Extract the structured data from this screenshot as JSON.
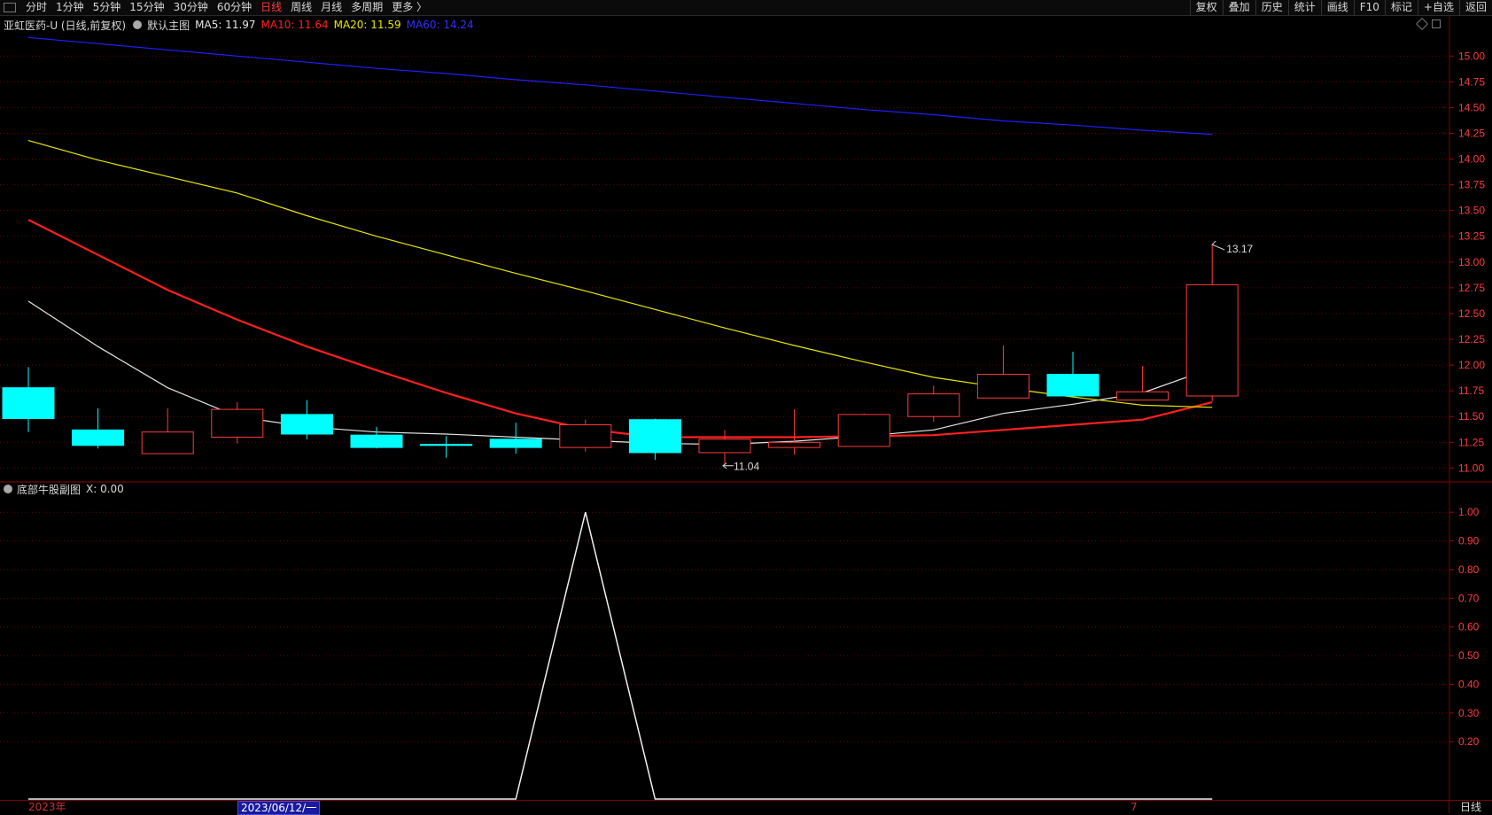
{
  "toolbar": {
    "tabs": [
      "分时",
      "1分钟",
      "5分钟",
      "15分钟",
      "30分钟",
      "60分钟",
      "日线",
      "周线",
      "月线",
      "多周期",
      "更多 〉"
    ],
    "active_tab": "日线",
    "right_buttons": [
      "复权",
      "叠加",
      "历史",
      "统计",
      "画线",
      "F10",
      "标记",
      "+自选",
      "返回"
    ]
  },
  "legend": {
    "stock": "亚虹医药-U (日线,前复权)",
    "template": "默认主图",
    "ma5": "MA5: 11.97",
    "ma10": "MA10: 11.64",
    "ma20": "MA20: 11.59",
    "ma60": "MA60: 14.24"
  },
  "sub_legend": {
    "name": "底部牛股副图",
    "x": "X: 0.00"
  },
  "colors": {
    "up": "#ff3b3b",
    "down": "#00ffff",
    "ma5": "#e6e6e6",
    "ma10": "#ff2020",
    "ma20": "#e8e800",
    "ma60": "#2020ff",
    "grid": "#6a0000",
    "axis_text": "#ff3b3b"
  },
  "bottom": {
    "year": "2023年",
    "cursor_date": "2023/06/12/一",
    "month": "7",
    "period": "日线"
  },
  "chart_data": [
    {
      "type": "candlestick",
      "title": "",
      "ylim": [
        10.9,
        15.2
      ],
      "yticks": [
        15.0,
        14.75,
        14.5,
        14.25,
        14.0,
        13.75,
        13.5,
        13.25,
        13.0,
        12.75,
        12.5,
        12.25,
        12.0,
        11.75,
        11.5,
        11.25,
        11.0
      ],
      "candles": [
        {
          "o": 11.78,
          "h": 11.98,
          "l": 11.35,
          "c": 11.48
        },
        {
          "o": 11.37,
          "h": 11.58,
          "l": 11.19,
          "c": 11.22
        },
        {
          "o": 11.14,
          "h": 11.58,
          "l": 11.14,
          "c": 11.35
        },
        {
          "o": 11.3,
          "h": 11.64,
          "l": 11.24,
          "c": 11.57
        },
        {
          "o": 11.52,
          "h": 11.66,
          "l": 11.28,
          "c": 11.33
        },
        {
          "o": 11.32,
          "h": 11.4,
          "l": 11.19,
          "c": 11.2
        },
        {
          "o": 11.23,
          "h": 11.31,
          "l": 11.1,
          "c": 11.22
        },
        {
          "o": 11.28,
          "h": 11.44,
          "l": 11.14,
          "c": 11.2
        },
        {
          "o": 11.2,
          "h": 11.47,
          "l": 11.16,
          "c": 11.42
        },
        {
          "o": 11.47,
          "h": 11.48,
          "l": 11.08,
          "c": 11.15
        },
        {
          "o": 11.15,
          "h": 11.37,
          "l": 11.04,
          "c": 11.28
        },
        {
          "o": 11.2,
          "h": 11.57,
          "l": 11.13,
          "c": 11.25
        },
        {
          "o": 11.21,
          "h": 11.53,
          "l": 11.21,
          "c": 11.52
        },
        {
          "o": 11.5,
          "h": 11.8,
          "l": 11.45,
          "c": 11.72
        },
        {
          "o": 11.68,
          "h": 12.19,
          "l": 11.68,
          "c": 11.91
        },
        {
          "o": 11.91,
          "h": 12.13,
          "l": 11.69,
          "c": 11.7
        },
        {
          "o": 11.66,
          "h": 11.99,
          "l": 11.66,
          "c": 11.74
        },
        {
          "o": 11.7,
          "h": 13.17,
          "l": 11.65,
          "c": 12.78
        }
      ],
      "annotations": [
        {
          "index": 17,
          "text": "13.17",
          "value": 13.17
        },
        {
          "index": 10,
          "text": "11.04",
          "value": 11.04
        }
      ],
      "series": [
        {
          "name": "MA5",
          "values": [
            12.62,
            12.18,
            11.78,
            11.5,
            11.4,
            11.35,
            11.33,
            11.3,
            11.27,
            11.24,
            11.23,
            11.26,
            11.31,
            11.37,
            11.53,
            11.62,
            11.73,
            11.97
          ]
        },
        {
          "name": "MA10",
          "values": [
            13.41,
            13.07,
            12.73,
            12.44,
            12.18,
            11.95,
            11.73,
            11.53,
            11.38,
            11.3,
            11.3,
            11.3,
            11.31,
            11.32,
            11.37,
            11.42,
            11.47,
            11.64
          ]
        },
        {
          "name": "MA20",
          "values": [
            14.18,
            13.99,
            13.83,
            13.67,
            13.45,
            13.25,
            13.07,
            12.89,
            12.72,
            12.54,
            12.36,
            12.19,
            12.03,
            11.88,
            11.78,
            11.69,
            11.61,
            11.59
          ]
        },
        {
          "name": "MA60",
          "values": [
            15.18,
            15.12,
            15.06,
            15.0,
            14.94,
            14.88,
            14.83,
            14.77,
            14.72,
            14.66,
            14.6,
            14.54,
            14.48,
            14.43,
            14.37,
            14.33,
            14.28,
            14.24
          ]
        }
      ]
    },
    {
      "type": "line",
      "title": "",
      "ylim": [
        0,
        1.05
      ],
      "yticks": [
        1.0,
        0.9,
        0.8,
        0.7,
        0.6,
        0.5,
        0.4,
        0.3,
        0.2
      ],
      "series": [
        {
          "name": "X",
          "values": [
            0,
            0,
            0,
            0,
            0,
            0,
            0,
            0,
            1,
            0,
            0,
            0,
            0,
            0,
            0,
            0,
            0,
            0
          ]
        }
      ]
    }
  ]
}
